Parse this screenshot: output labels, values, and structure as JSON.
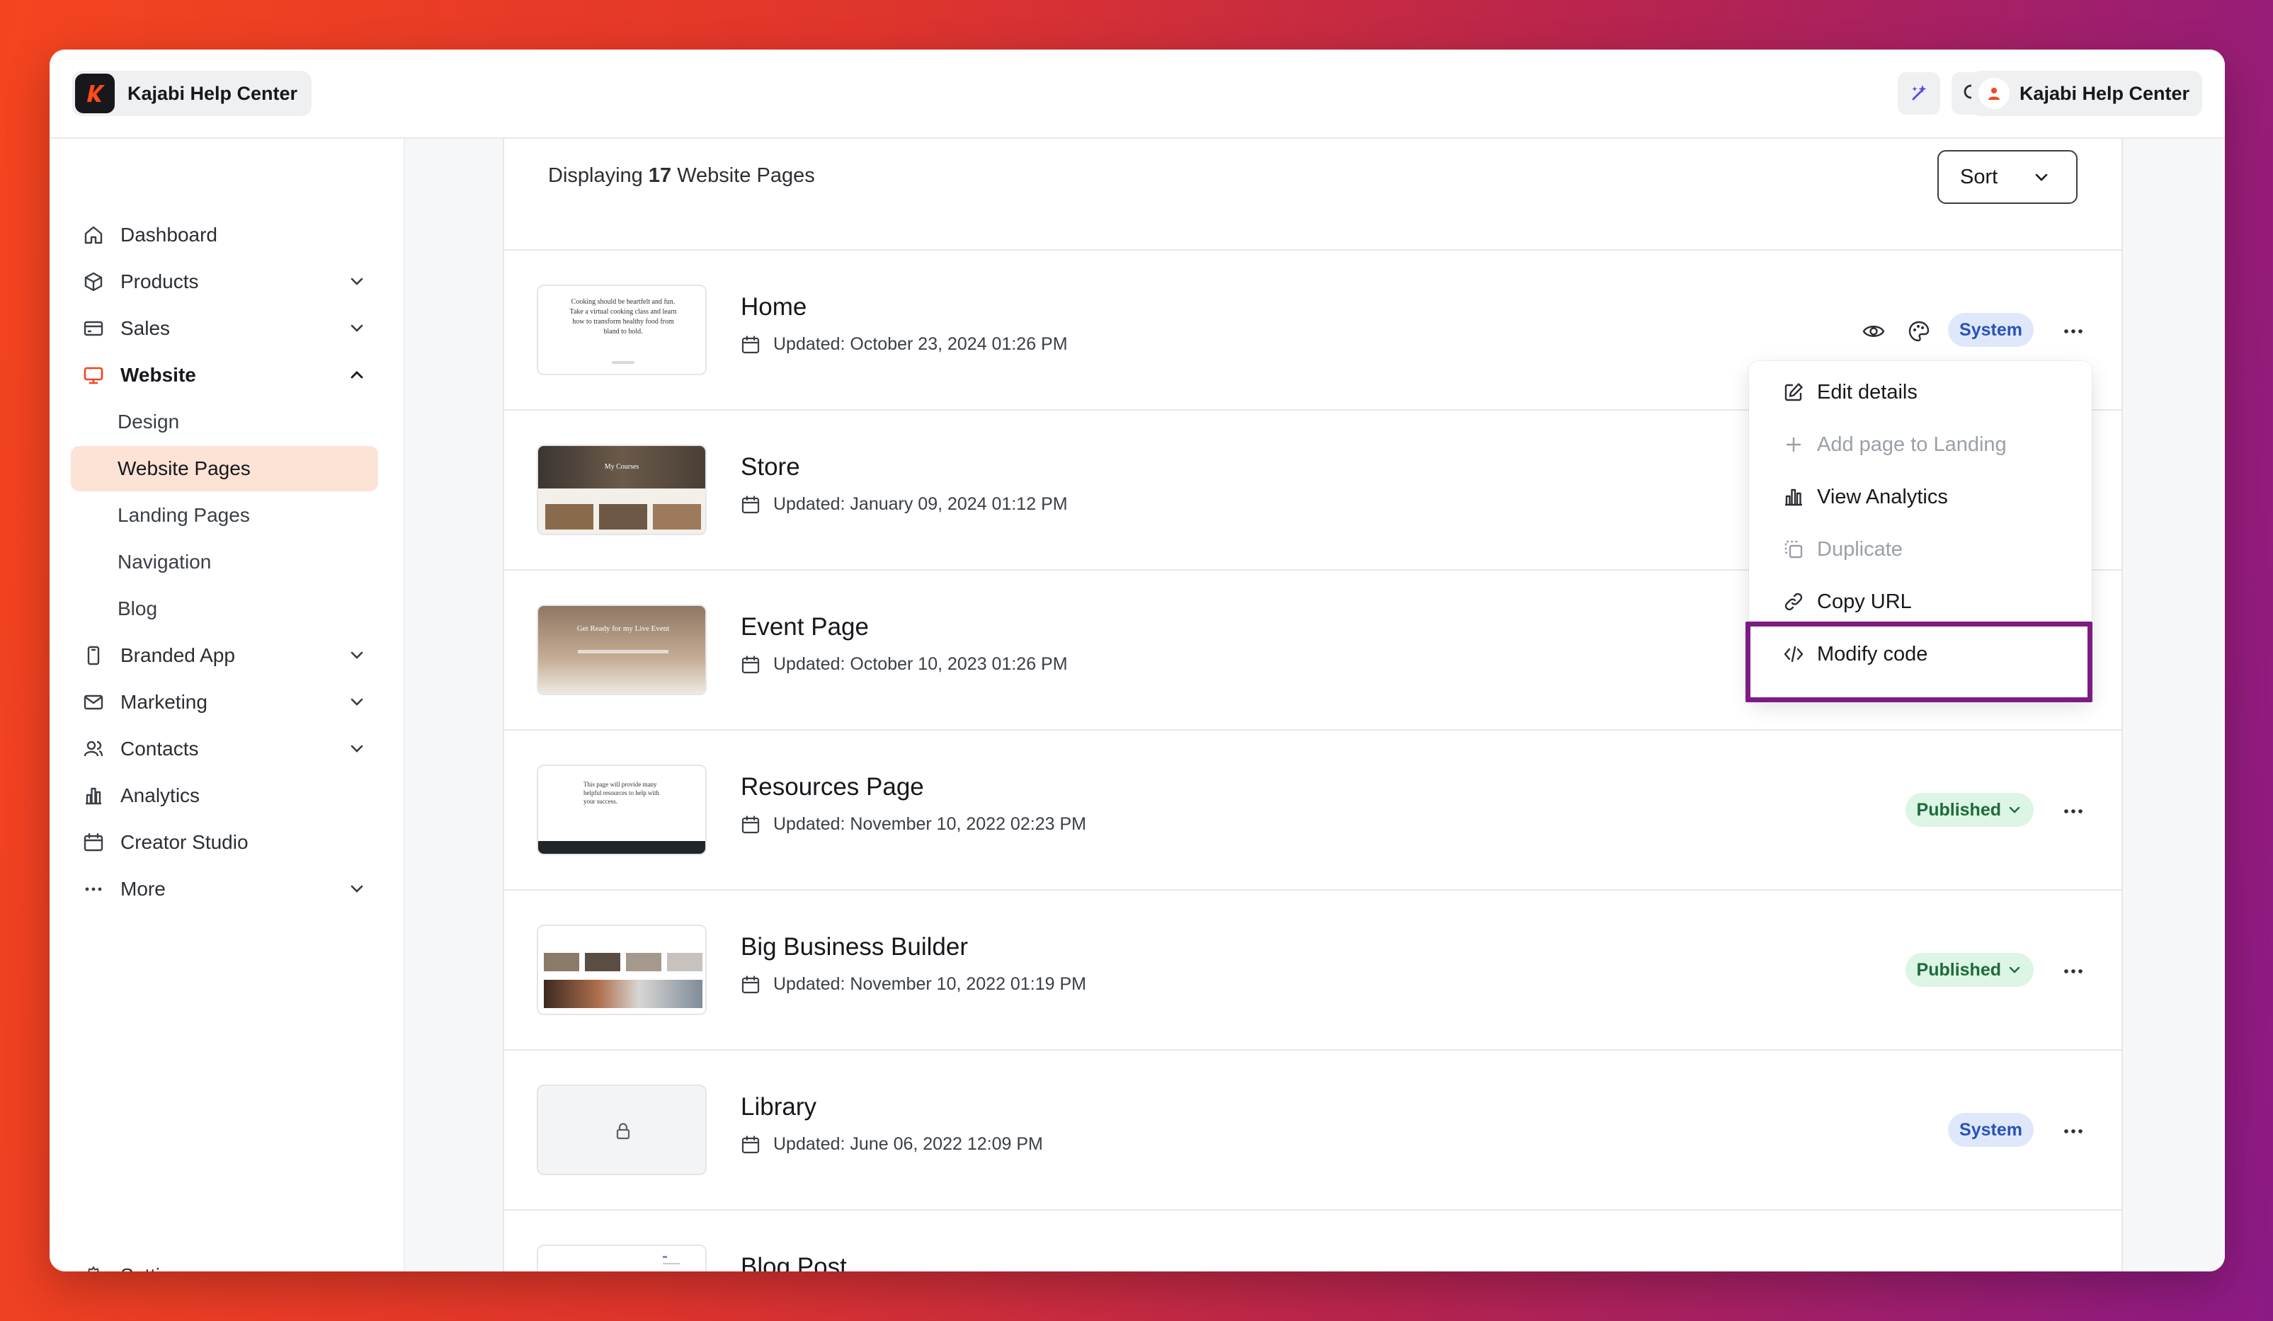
{
  "app": {
    "brand": "Kajabi Help Center",
    "account_name": "Kajabi Help Center"
  },
  "sidebar": {
    "items": [
      {
        "label": "Dashboard",
        "icon": "home-icon"
      },
      {
        "label": "Products",
        "icon": "cube-icon",
        "expandable": true
      },
      {
        "label": "Sales",
        "icon": "card-icon",
        "expandable": true
      },
      {
        "label": "Website",
        "icon": "monitor-icon",
        "expanded": true,
        "active": true
      },
      {
        "label": "Branded App",
        "icon": "phone-icon",
        "expandable": true
      },
      {
        "label": "Marketing",
        "icon": "mail-icon",
        "expandable": true
      },
      {
        "label": "Contacts",
        "icon": "users-icon",
        "expandable": true
      },
      {
        "label": "Analytics",
        "icon": "bar-chart-icon"
      },
      {
        "label": "Creator Studio",
        "icon": "calendar-icon"
      },
      {
        "label": "More",
        "icon": "dots-icon",
        "expandable": true
      }
    ],
    "website_sub": [
      "Design",
      "Website Pages",
      "Landing Pages",
      "Navigation",
      "Blog"
    ],
    "selected_sub": "Website Pages",
    "settings_label": "Settings"
  },
  "main": {
    "display_prefix": "Displaying",
    "display_count": "17",
    "display_suffix": "Website Pages",
    "sort_label": "Sort",
    "pages": [
      {
        "title": "Home",
        "updated": "Updated: October 23, 2024 01:26 PM",
        "status": "System"
      },
      {
        "title": "Store",
        "updated": "Updated: January 09, 2024 01:12 PM",
        "status": ""
      },
      {
        "title": "Event Page",
        "updated": "Updated: October 10, 2023 01:26 PM",
        "status": ""
      },
      {
        "title": "Resources Page",
        "updated": "Updated: November 10, 2022 02:23 PM",
        "status": "Published"
      },
      {
        "title": "Big Business Builder",
        "updated": "Updated: November 10, 2022 01:19 PM",
        "status": "Published"
      },
      {
        "title": "Library",
        "updated": "Updated: June 06, 2022 12:09 PM",
        "status": "System"
      },
      {
        "title": "Blog Post",
        "updated": "",
        "status": ""
      }
    ],
    "thumb_text": {
      "home": "Cooking should be heartfelt and fun. Take a virtual cooking class and learn how to transform healthy food from bland to bold.",
      "store": "My Courses",
      "event": "Get Ready for my Live Event",
      "resources": "This page will provide many helpful resources to help with your success."
    }
  },
  "menu": {
    "items": [
      {
        "label": "Edit details",
        "icon": "edit-icon",
        "disabled": false
      },
      {
        "label": "Add page to Landing",
        "icon": "plus-icon",
        "disabled": true
      },
      {
        "label": "View Analytics",
        "icon": "analytics-icon",
        "disabled": false
      },
      {
        "label": "Duplicate",
        "icon": "duplicate-icon",
        "disabled": true
      },
      {
        "label": "Copy URL",
        "icon": "link-icon",
        "disabled": false
      },
      {
        "label": "Modify code",
        "icon": "code-icon",
        "disabled": false
      }
    ],
    "highlighted": "Modify code"
  },
  "colors": {
    "accent_orange": "#f4441f",
    "highlight_purple": "#7d1b86",
    "selected_bg": "#fde2d6",
    "system_badge": "#dfe8fb",
    "published_badge": "#dcf5e4"
  }
}
